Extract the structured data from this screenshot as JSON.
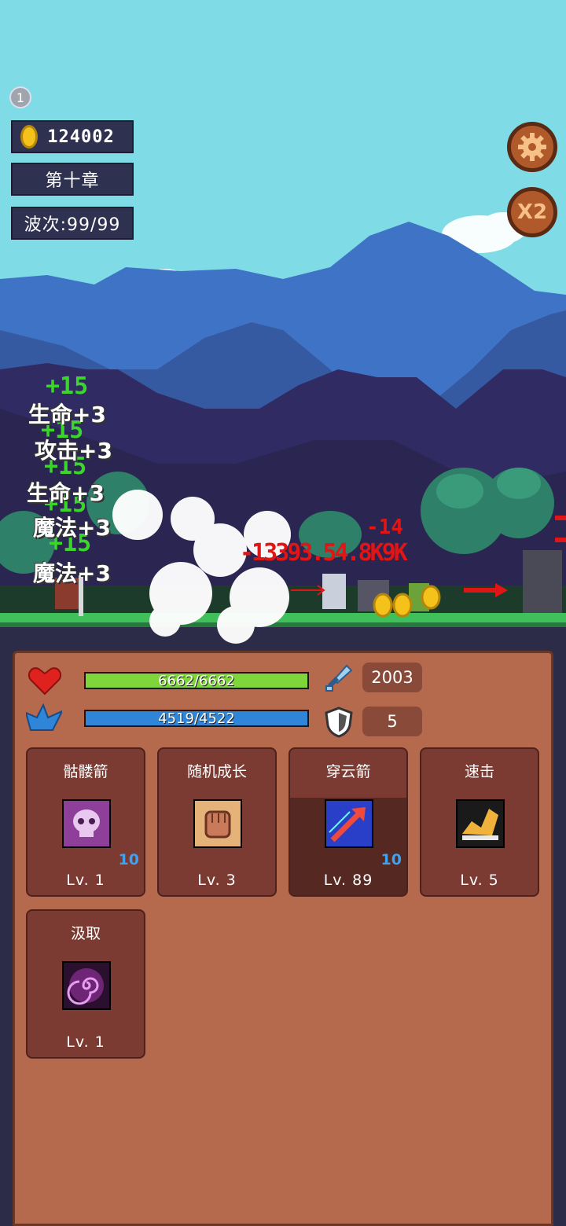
{
  "hud": {
    "badge": "1",
    "coins": "124002",
    "chapter": "第十章",
    "wave": "波次:99/99"
  },
  "buttons": {
    "settings_icon": "gear-icon",
    "speed": "X2"
  },
  "battle": {
    "heal_numbers": [
      "+15",
      "+15",
      "+15",
      "+15",
      "+15"
    ],
    "stat_gains": [
      "生命+3",
      "攻击+3",
      "生命+3",
      "魔法+3",
      "魔法+3"
    ],
    "damage_text": "-13393.54.8K9K",
    "damage_small": "-14"
  },
  "stats": {
    "hp": {
      "current": 6662,
      "max": 6662,
      "text": "6662/6662"
    },
    "mp": {
      "current": 4519,
      "max": 4522,
      "text": "4519/4522"
    },
    "attack": "2003",
    "defense": "5"
  },
  "skills": [
    {
      "name": "骷髅箭",
      "level": "Lv. 1",
      "count": "10",
      "icon": "skull-icon"
    },
    {
      "name": "随机成长",
      "level": "Lv. 3",
      "count": "",
      "icon": "fist-icon"
    },
    {
      "name": "穿云箭",
      "level": "Lv. 89",
      "count": "10",
      "icon": "arrow-icon"
    },
    {
      "name": "速击",
      "level": "Lv. 5",
      "count": "",
      "icon": "swift-strike-icon"
    },
    {
      "name": "汲取",
      "level": "Lv. 1",
      "count": "",
      "icon": "vortex-icon"
    }
  ],
  "colors": {
    "hp": "#7fd63b",
    "mp": "#2f86d8",
    "panel": "#b5694d",
    "card": "#7b3b32"
  }
}
